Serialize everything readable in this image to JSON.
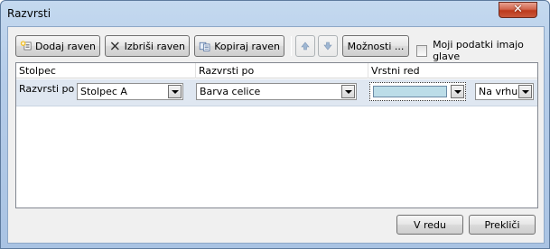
{
  "window": {
    "title": "Razvrsti",
    "close_glyph": "✕"
  },
  "toolbar": {
    "add_label": "Dodaj raven",
    "delete_label": "Izbriši raven",
    "copy_label": "Kopiraj raven",
    "options_label": "Možnosti ...",
    "headers_checkbox_label": "Moji podatki imajo glave",
    "headers_checked": false
  },
  "grid": {
    "columns": [
      "Stolpec",
      "Razvrsti po",
      "Vrstni red"
    ],
    "rows": [
      {
        "label": "Razvrsti po",
        "column": "Stolpec A",
        "sort_on": "Barva celice",
        "color_swatch": "#bcdde8",
        "position": "Na vrhu"
      }
    ]
  },
  "footer": {
    "ok_label": "V redu",
    "cancel_label": "Prekliči"
  },
  "colors": {
    "title_bar": "#b6cde9",
    "close": "#c8573a",
    "row_highlight": "#dfe7f1"
  }
}
